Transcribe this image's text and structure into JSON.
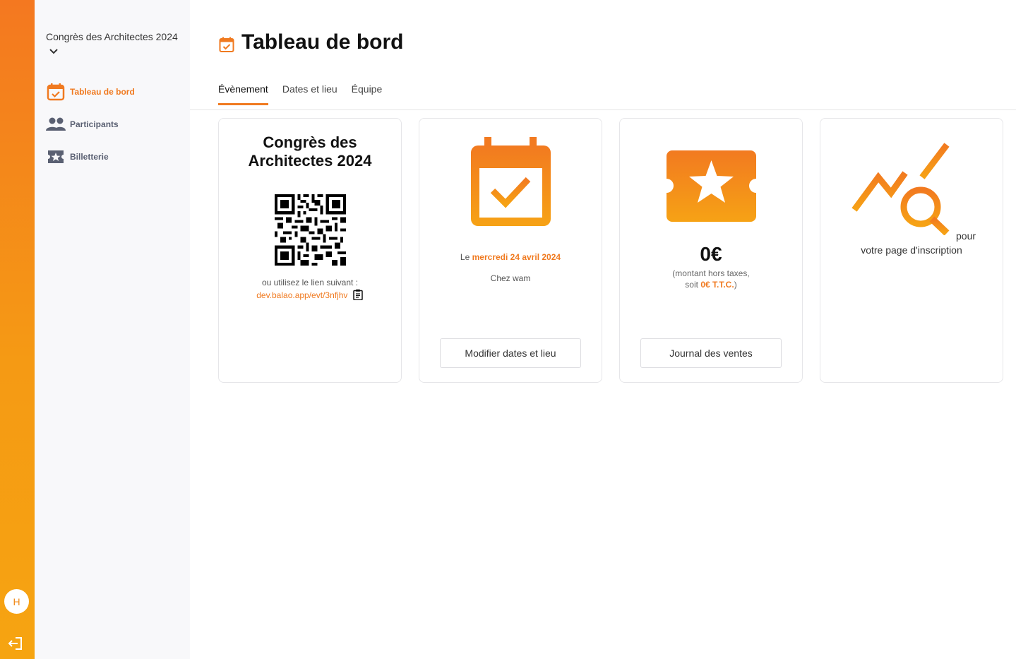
{
  "rail": {
    "avatar_initial": "H",
    "colors": {
      "top": "#f47820",
      "bottom": "#f6a411"
    }
  },
  "sidebar": {
    "event_name": "Congrès des Architectes 2024",
    "items": [
      {
        "label": "Tableau de bord",
        "icon": "calendar-check-icon",
        "active": true
      },
      {
        "label": "Participants",
        "icon": "people-icon",
        "active": false
      },
      {
        "label": "Billetterie",
        "icon": "ticket-star-icon",
        "active": false
      }
    ]
  },
  "header": {
    "title": "Tableau de bord",
    "tabs": [
      {
        "label": "Évènement",
        "active": true
      },
      {
        "label": "Dates et lieu",
        "active": false
      },
      {
        "label": "Équipe",
        "active": false
      }
    ]
  },
  "cards": {
    "event": {
      "title": "Congrès des Architectes 2024",
      "link_hint": "ou utilisez le lien suivant :",
      "link": "dev.balao.app/evt/3nfjhv"
    },
    "dates": {
      "date_prefix": "Le",
      "date": "mercredi 24 avril 2024",
      "place": "Chez wam",
      "button": "Modifier dates et lieu"
    },
    "sales": {
      "amount": "0€",
      "note_line1": "(montant hors taxes,",
      "note_prefix": "soit",
      "ttc": "0€ T.T.C.",
      "note_suffix": ")",
      "button": "Journal des ventes"
    },
    "stats": {
      "pour": "pour",
      "text": "votre page d'inscription"
    }
  },
  "accent_color": "#f07a20"
}
